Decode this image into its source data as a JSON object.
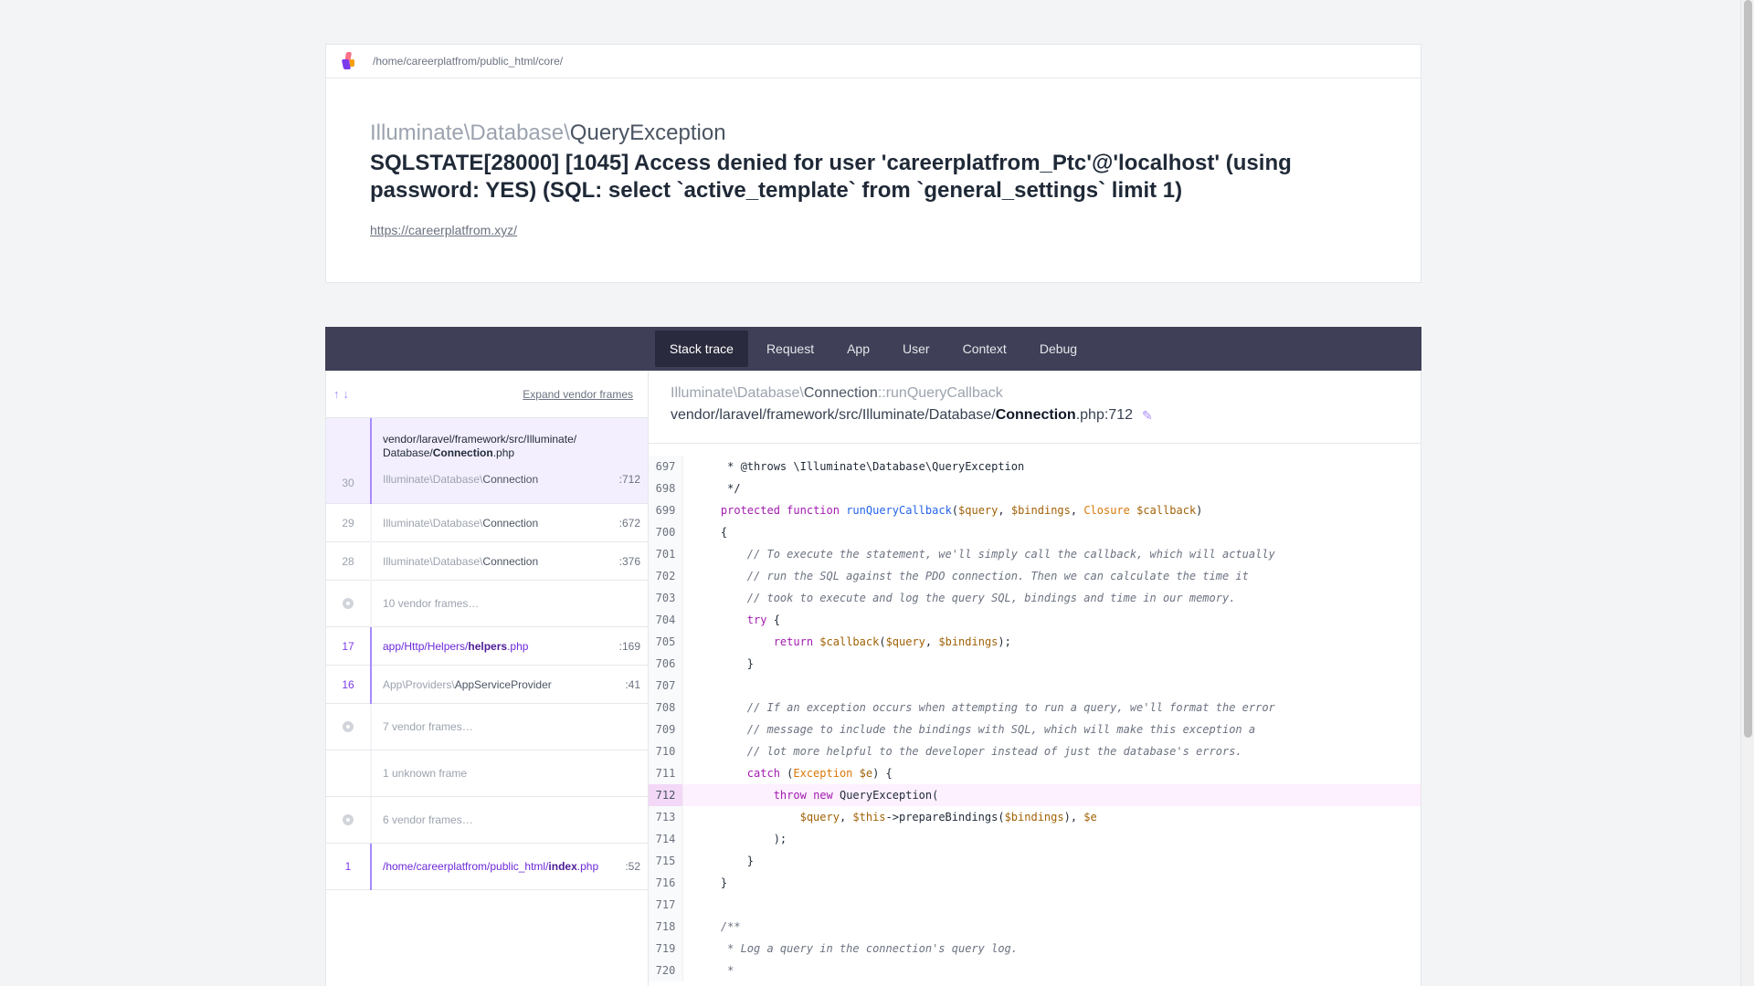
{
  "nav": {
    "path": "/home/careerplatfrom/public_html/core/"
  },
  "exception": {
    "namespace": "Illuminate\\Database\\",
    "class_name": "QueryException",
    "message": "SQLSTATE[28000] [1045] Access denied for user 'careerplatfrom_Ptc'@'localhost' (using password: YES) (SQL: select `active_template` from `general_settings` limit 1)",
    "url": "https://careerplatfrom.xyz/"
  },
  "tabs": [
    {
      "label": "Stack trace",
      "active": true
    },
    {
      "label": "Request",
      "active": false
    },
    {
      "label": "App",
      "active": false
    },
    {
      "label": "User",
      "active": false
    },
    {
      "label": "Context",
      "active": false
    },
    {
      "label": "Debug",
      "active": false
    }
  ],
  "frames_panel": {
    "expand_label": "Expand vendor frames",
    "top_group": {
      "file_prefix": "vendor/laravel/framework/src/Illuminate/",
      "file_prefix2": "Database/",
      "file_name": "Connection",
      "file_ext": ".php",
      "rows": [
        {
          "num": "30",
          "ns": "Illuminate\\Database\\",
          "cls": "Connection",
          "line": ":712"
        },
        {
          "num": "29",
          "ns": "Illuminate\\Database\\",
          "cls": "Connection",
          "line": ":672"
        },
        {
          "num": "28",
          "ns": "Illuminate\\Database\\",
          "cls": "Connection",
          "line": ":376"
        }
      ]
    },
    "vendor_10": "10 vendor frames…",
    "app_frame_17": {
      "num": "17",
      "prefix": "app/Http/Helpers/",
      "name": "helpers",
      "ext": ".php",
      "line": ":169"
    },
    "app_frame_16": {
      "num": "16",
      "ns": "App\\Providers\\",
      "cls": "AppServiceProvider",
      "line": ":41"
    },
    "vendor_7": "7 vendor frames…",
    "unknown_1": "1 unknown frame",
    "vendor_6": "6 vendor frames…",
    "app_frame_1": {
      "num": "1",
      "prefix": "/home/careerplatfrom/public_html/",
      "name": "index",
      "ext": ".php",
      "line": ":52"
    }
  },
  "code": {
    "fn_ns": "Illuminate\\Database\\",
    "fn_cls": "Connection",
    "fn_method": "::runQueryCallback",
    "file_prefix": "vendor/laravel/framework/src/Illuminate/Database/",
    "file_name": "Connection",
    "file_suffix": ".php:712",
    "lines": [
      {
        "n": "697",
        "html": "     * @throws \\Illuminate\\Database\\QueryException"
      },
      {
        "n": "698",
        "html": "     */"
      },
      {
        "n": "699",
        "html": "    <span class=\"kw\">protected</span> <span class=\"kw\">function</span> <span class=\"fnname\">runQueryCallback</span>(<span class=\"var\">$query</span>, <span class=\"var\">$bindings</span>, <span class=\"type\">Closure</span> <span class=\"var\">$callback</span>)"
      },
      {
        "n": "700",
        "html": "    {"
      },
      {
        "n": "701",
        "html": "        <span class=\"cmt\">// To execute the statement, we'll simply call the callback, which will actually</span>"
      },
      {
        "n": "702",
        "html": "        <span class=\"cmt\">// run the SQL against the PDO connection. Then we can calculate the time it</span>"
      },
      {
        "n": "703",
        "html": "        <span class=\"cmt\">// took to execute and log the query SQL, bindings and time in our memory.</span>"
      },
      {
        "n": "704",
        "html": "        <span class=\"kw\">try</span> {"
      },
      {
        "n": "705",
        "html": "            <span class=\"kw\">return</span> <span class=\"var\">$callback</span>(<span class=\"var\">$query</span>, <span class=\"var\">$bindings</span>);"
      },
      {
        "n": "706",
        "html": "        }"
      },
      {
        "n": "707",
        "html": ""
      },
      {
        "n": "708",
        "html": "        <span class=\"cmt\">// If an exception occurs when attempting to run a query, we'll format the error</span>"
      },
      {
        "n": "709",
        "html": "        <span class=\"cmt\">// message to include the bindings with SQL, which will make this exception a</span>"
      },
      {
        "n": "710",
        "html": "        <span class=\"cmt\">// lot more helpful to the developer instead of just the database's errors.</span>"
      },
      {
        "n": "711",
        "html": "        <span class=\"kw\">catch</span> (<span class=\"type\">Exception</span> <span class=\"var\">$e</span>) {"
      },
      {
        "n": "712",
        "html": "            <span class=\"kw\">throw</span> <span class=\"kw\">new</span> QueryException(",
        "highlight": true
      },
      {
        "n": "713",
        "html": "                <span class=\"var\">$query</span>, <span class=\"var\">$this</span>-&gt;prepareBindings(<span class=\"var\">$bindings</span>), <span class=\"var\">$e</span>"
      },
      {
        "n": "714",
        "html": "            );"
      },
      {
        "n": "715",
        "html": "        }"
      },
      {
        "n": "716",
        "html": "    }"
      },
      {
        "n": "717",
        "html": ""
      },
      {
        "n": "718",
        "html": "    <span class=\"cmt\">/**</span>"
      },
      {
        "n": "719",
        "html": "<span class=\"cmt\">     * Log a query in the connection's query log.</span>"
      },
      {
        "n": "720",
        "html": "<span class=\"cmt\">     *</span>"
      }
    ]
  }
}
